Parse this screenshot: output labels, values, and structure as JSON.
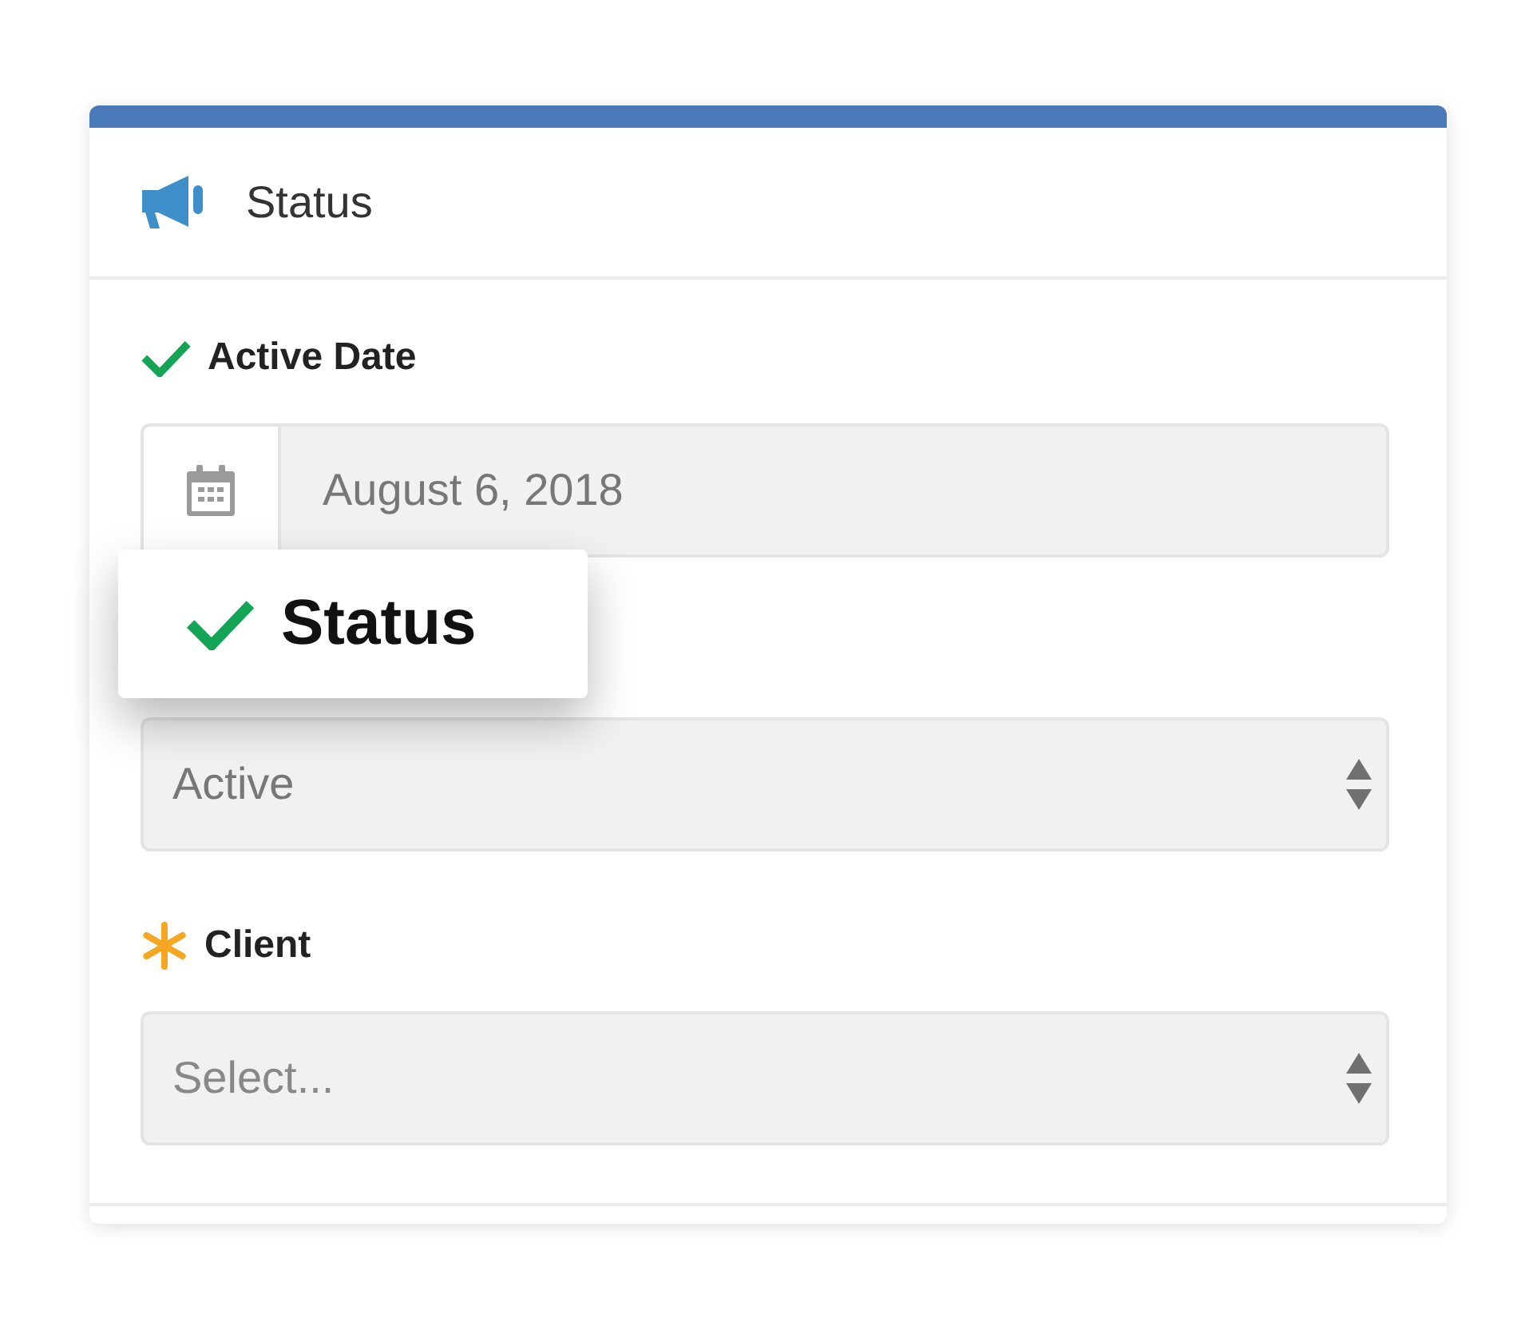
{
  "header": {
    "title": "Status"
  },
  "fields": [
    {
      "kind": "date",
      "label": "Active Date",
      "valid": true,
      "value": "August 6, 2018"
    },
    {
      "kind": "select",
      "value": "Active"
    },
    {
      "kind": "select",
      "label": "Client",
      "required": true,
      "placeholder": "Select..."
    }
  ],
  "callout": {
    "label": "Status"
  }
}
